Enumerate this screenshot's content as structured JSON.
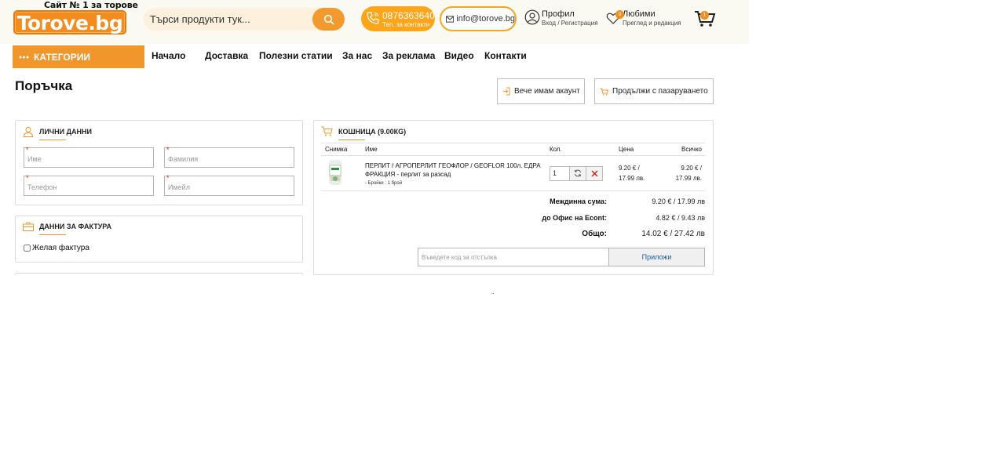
{
  "header": {
    "logo_tagline": "Сайт № 1 за торове",
    "logo_text": "Torove.bg",
    "search_placeholder": "Търси продукти тук...",
    "phone_number": "0876363640",
    "phone_sub": "Тел. за контакти",
    "email": "info@torove.bg",
    "profile_label": "Профил",
    "profile_sub": "Вход / Регистрация",
    "favorites_label": "Любими",
    "favorites_sub": "Преглед и редакция",
    "favorites_count": "0",
    "cart_count": "1",
    "accent_color": "#f0962a"
  },
  "nav": {
    "categories_label": "КАТЕГОРИИ",
    "links": [
      "Начало",
      "Доставка",
      "Полезни статии",
      "За нас",
      "За реклама",
      "Видео",
      "Контакти"
    ]
  },
  "page": {
    "title": "Поръчка",
    "have_account_label": "Вече имам акаунт",
    "continue_shopping_label": "Продължи с пазаруването"
  },
  "personal": {
    "title": "ЛИЧНИ ДАННИ",
    "first_name_placeholder": "Име",
    "last_name_placeholder": "Фамилия",
    "phone_placeholder": "Телефон",
    "email_placeholder": "Имейл",
    "required_mark": "*"
  },
  "invoice": {
    "title": "ДАННИ ЗА ФАКТУРА",
    "checkbox_label": "Желая фактура",
    "checked": false
  },
  "cart": {
    "title": "КОШНИЦА (9.00КG)",
    "columns": [
      "Снимка",
      "Име",
      "Кол.",
      "Цена",
      "Всичко"
    ],
    "items": [
      {
        "name": "ПЕРЛИТ / АГРОПЕРЛИТ ГЕОФЛОР / GEOFLOR 100л. ЕДРА ФРАКЦИЯ - перлит за разсад",
        "meta": "- Бройки : 1 брой",
        "quantity": "1",
        "price_line1": "9.20 € /",
        "price_line2": "17.99 лв.",
        "total_line1": "9.20 € /",
        "total_line2": "17.99 лв."
      }
    ],
    "subtotal_label": "Междинна сума:",
    "subtotal_value": "9.20 € / 17.99 лв",
    "shipping_label": "до Офис на Econt:",
    "shipping_value": "4.82 € / 9.43 лв",
    "total_label": "Общо:",
    "total_value": "14.02 € / 27.42 лв",
    "coupon_placeholder": "Въведете код за отстъпка",
    "coupon_button": "Приложи"
  },
  "footer": {
    "dot": "."
  }
}
